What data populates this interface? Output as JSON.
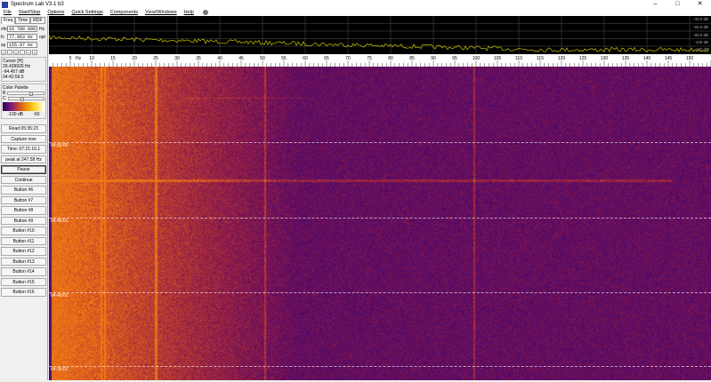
{
  "window": {
    "title": "Spectrum Lab V3.1 b3",
    "controls": [
      "–",
      "□",
      "✕"
    ]
  },
  "menu": [
    "File",
    "Start/Stop",
    "Options",
    "Quick Settings",
    "Components",
    "View/Windows",
    "Help"
  ],
  "left": {
    "tabs": [
      "Freq",
      "Time",
      "RDF"
    ],
    "vfo": {
      "label": "vfo",
      "value": "10 700 000",
      "unit": "Hz"
    },
    "fc": {
      "label": "fc",
      "value": "77.963 Hz",
      "button": "opt"
    },
    "sp": {
      "label": "sp",
      "value": "155.97 Hz"
    },
    "arrows": [
      "«",
      "‹",
      "»",
      "-",
      "+",
      "»"
    ],
    "cursor": {
      "title": "Cursor [H]",
      "freq": "29.439926 Hz",
      "level": "-94.457 dB",
      "time": "04:42:59.5"
    },
    "palette": {
      "title": "Color Palette",
      "b": "B",
      "c": "C",
      "min": "-100 dB",
      "max": "-50",
      "brightness": 0.6,
      "contrast": 0.35
    },
    "buttons": [
      "Read 05:35:23",
      "Capture now",
      "Time:  07:21:16.1",
      "peak at 247.58 Hz",
      "Pause",
      "Continue",
      "Button #6",
      "Button #7",
      "Button #8",
      "Button #9",
      "Button #10",
      "Button #11",
      "Button #12",
      "Button #13",
      "Button #14",
      "Button #15",
      "Button #16"
    ]
  },
  "spectrum": {
    "db_labels": [
      "-40.0 dB",
      "-60.0 dB",
      "-80.0 dB",
      "-100 dB",
      "-120 dB"
    ],
    "trace_color": "#c8c800"
  },
  "freq_axis": {
    "unit_label": "Hz",
    "min_hz": 0,
    "max_hz": 155,
    "labels": [
      "5",
      "10",
      "15",
      "20",
      "25",
      "30",
      "35",
      "40",
      "45",
      "50",
      "55",
      "60",
      "65",
      "70",
      "75",
      "80",
      "85",
      "90",
      "95",
      "100",
      "105",
      "110",
      "115",
      "120",
      "125",
      "130",
      "135",
      "140",
      "145",
      "150"
    ]
  },
  "waterfall": {
    "time_labels": [
      "04:50:00",
      "04:45:01",
      "04:40:01",
      "04:35:01"
    ]
  }
}
